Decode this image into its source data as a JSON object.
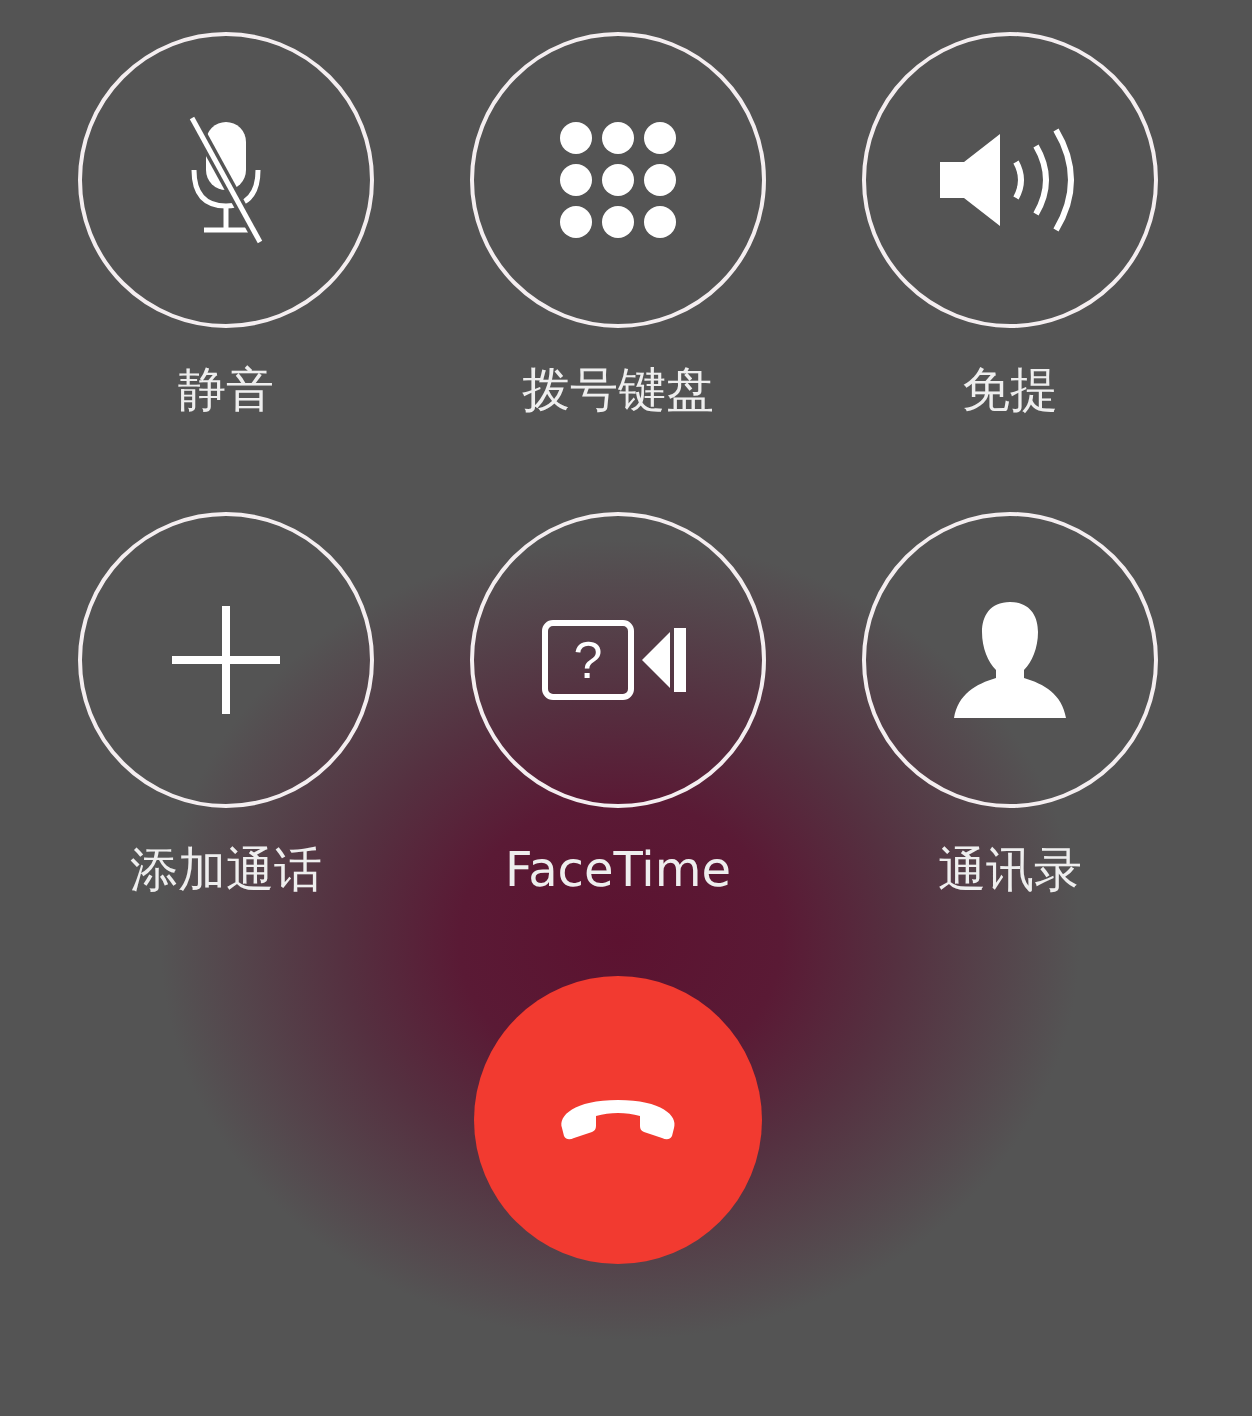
{
  "call_controls": [
    {
      "kind": "mute",
      "label": "静音"
    },
    {
      "kind": "keypad",
      "label": "拨号键盘"
    },
    {
      "kind": "speaker",
      "label": "免提"
    },
    {
      "kind": "add",
      "label": "添加通话"
    },
    {
      "kind": "facetime",
      "label": "FaceTime",
      "icon_text": "?"
    },
    {
      "kind": "contacts",
      "label": "通讯录"
    }
  ],
  "end_call": {
    "kind": "end"
  }
}
